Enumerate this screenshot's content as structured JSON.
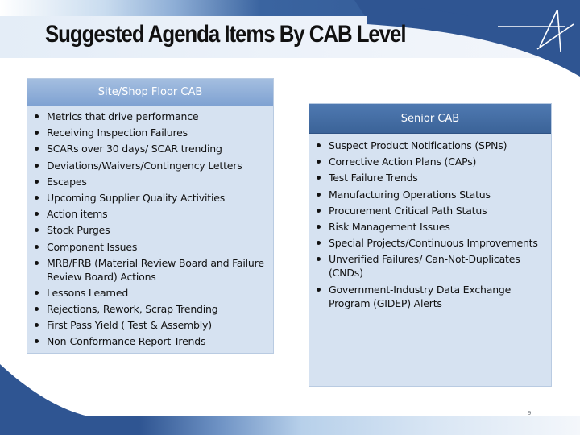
{
  "slide": {
    "title": "Suggested Agenda Items By CAB Level",
    "page_number": "9",
    "logo": "company-star-logo-icon"
  },
  "colors": {
    "brand_blue": "#2f5592",
    "panel_fill": "#d6e2f1",
    "left_header": "#8aaad6",
    "right_header": "#4470a6"
  },
  "panels": {
    "site_shop_floor": {
      "title": "Site/Shop Floor CAB",
      "items": [
        "Metrics that drive performance",
        "Receiving Inspection Failures",
        "SCARs over 30 days/ SCAR trending",
        "Deviations/Waivers/Contingency Letters",
        "Escapes",
        "Upcoming Supplier Quality Activities",
        "Action items",
        "Stock Purges",
        "Component Issues",
        "MRB/FRB (Material Review Board and Failure Review Board)  Actions",
        "Lessons Learned",
        "Rejections, Rework, Scrap Trending",
        "First Pass Yield ( Test & Assembly)",
        "Non-Conformance Report Trends"
      ]
    },
    "senior": {
      "title": "Senior CAB",
      "items": [
        "Suspect Product Notifications (SPNs)",
        "Corrective Action Plans (CAPs)",
        "Test Failure Trends",
        "Manufacturing Operations Status",
        "Procurement Critical Path Status",
        "Risk Management Issues",
        "Special Projects/Continuous Improvements",
        "Unverified Failures/ Can-Not-Duplicates (CNDs)",
        "Government-Industry Data Exchange Program (GIDEP) Alerts"
      ]
    }
  }
}
